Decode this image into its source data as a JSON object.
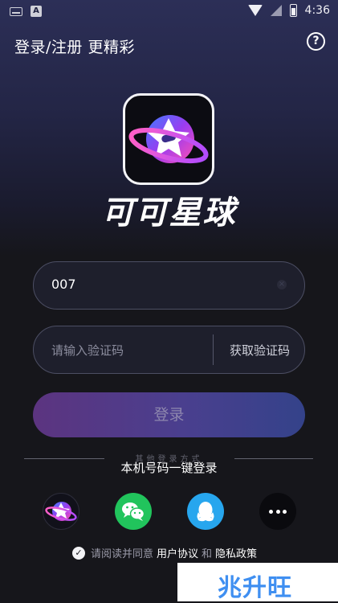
{
  "status_bar": {
    "time": "4:36",
    "a_label": "A"
  },
  "header": {
    "title": "登录/注册 更精彩",
    "help_symbol": "?"
  },
  "app": {
    "name": "可可星球",
    "logo_icon": "planet-star-icon"
  },
  "login_form": {
    "phone_value": "007",
    "clear_symbol": "×",
    "code_placeholder": "请输入验证码",
    "get_code_label": "获取验证码",
    "submit_label": "登录"
  },
  "other_methods": {
    "label": "其他登录方式",
    "one_click_label": "本机号码一键登录",
    "icons": [
      "planet-star-icon",
      "wechat-icon",
      "qq-icon",
      "more-icon"
    ]
  },
  "agreement": {
    "check_symbol": "✓",
    "prefix": "请阅读并同意",
    "user_agreement": "用户协议",
    "and": "和",
    "privacy_policy": "隐私政策"
  },
  "watermark": {
    "text": "兆升旺"
  },
  "colors": {
    "background": "#16161b",
    "field_border": "#4c4e63",
    "button_gradient_start": "#5c3480",
    "button_gradient_end": "#34428a",
    "wechat": "#21c45c",
    "qq": "#27a6ee",
    "watermark_blue": "#3f8ff1"
  }
}
